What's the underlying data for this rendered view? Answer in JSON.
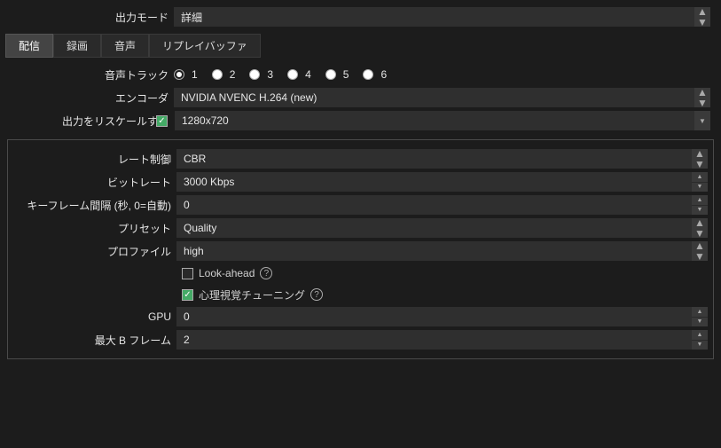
{
  "top": {
    "output_mode_label": "出力モード",
    "output_mode_value": "詳細"
  },
  "tabs": {
    "stream": "配信",
    "record": "録画",
    "audio": "音声",
    "replay": "リプレイバッファ"
  },
  "stream": {
    "audio_track_label": "音声トラック",
    "tracks": [
      "1",
      "2",
      "3",
      "4",
      "5",
      "6"
    ],
    "selected_track": "1",
    "encoder_label": "エンコーダ",
    "encoder_value": "NVIDIA NVENC H.264 (new)",
    "rescale_label": "出力をリスケールする",
    "rescale_checked": true,
    "rescale_value": "1280x720"
  },
  "encoder": {
    "rate_control_label": "レート制御",
    "rate_control_value": "CBR",
    "bitrate_label": "ビットレート",
    "bitrate_value": "3000 Kbps",
    "keyframe_label": "キーフレーム間隔 (秒, 0=自動)",
    "keyframe_value": "0",
    "preset_label": "プリセット",
    "preset_value": "Quality",
    "profile_label": "プロファイル",
    "profile_value": "high",
    "lookahead_label": "Look-ahead",
    "lookahead_checked": false,
    "psycho_label": "心理視覚チューニング",
    "psycho_checked": true,
    "gpu_label": "GPU",
    "gpu_value": "0",
    "bframes_label": "最大 B フレーム",
    "bframes_value": "2"
  }
}
